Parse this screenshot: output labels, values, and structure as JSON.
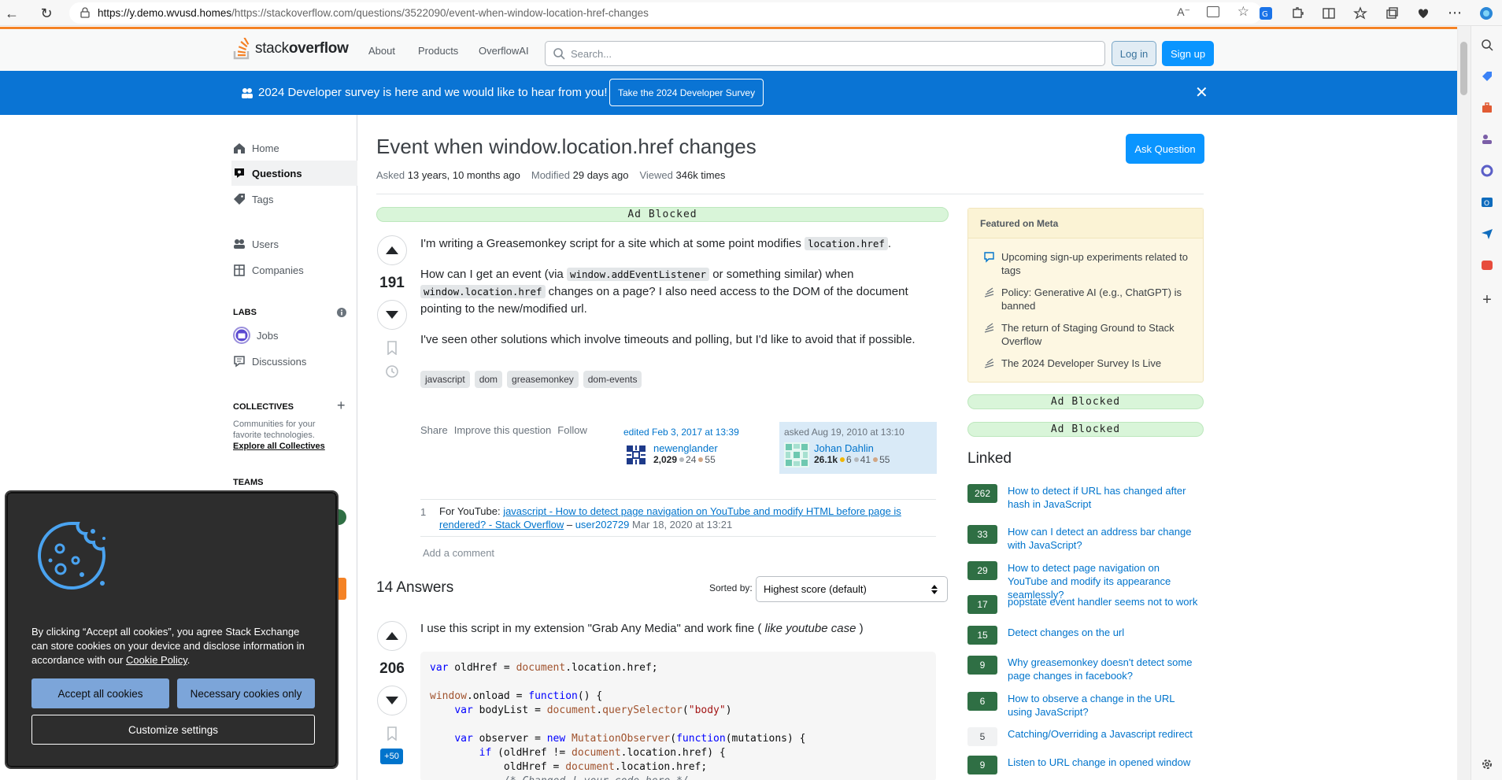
{
  "browser": {
    "url_host": "https://y.demo.wvusd.homes",
    "url_path": "/https://stackoverflow.com/questions/3522090/event-when-window-location-href-changes"
  },
  "header": {
    "logo_text_a": "stack",
    "logo_text_b": "overflow",
    "nav": [
      "About",
      "Products",
      "OverflowAI"
    ],
    "search_placeholder": "Search...",
    "login": "Log in",
    "signup": "Sign up"
  },
  "banner": {
    "message": "2024 Developer survey is here and we would like to hear from you!",
    "button": "Take the 2024 Developer Survey"
  },
  "sidebar": {
    "home": "Home",
    "questions": "Questions",
    "tags": "Tags",
    "users": "Users",
    "companies": "Companies",
    "labs_heading": "LABS",
    "jobs": "Jobs",
    "discussions": "Discussions",
    "collectives_heading": "COLLECTIVES",
    "collectives_desc": "Communities for your favorite technologies.",
    "collectives_link": "Explore all Collectives",
    "teams_heading": "TEAMS"
  },
  "question": {
    "title": "Event when window.location.href changes",
    "ask_button": "Ask Question",
    "asked_label": "Asked",
    "asked_value": "13 years, 10 months ago",
    "modified_label": "Modified",
    "modified_value": "29 days ago",
    "viewed_label": "Viewed",
    "viewed_value": "346k times",
    "score": "191",
    "p1_a": "I'm writing a Greasemonkey script for a site which at some point modifies ",
    "p1_code": "location.href",
    "p1_b": ".",
    "p2_a": "How can I get an event (via ",
    "p2_code1": "window.addEventListener",
    "p2_b": " or something similar) when",
    "p2_code2": "window.location.href",
    "p2_c": " changes on a page? I also need access to the DOM of the document pointing to the new/modified url.",
    "p3": "I've seen other solutions which involve timeouts and polling, but I'd like to avoid that if possible.",
    "tags": [
      "javascript",
      "dom",
      "greasemonkey",
      "dom-events"
    ],
    "menu": [
      "Share",
      "Improve this question",
      "Follow"
    ],
    "edited_label": "edited Feb 3, 2017 at 13:39",
    "editor_name": "newenglander",
    "editor_rep": "2,029",
    "editor_silver": "24",
    "editor_bronze": "55",
    "asked_box_label": "asked Aug 19, 2010 at 13:10",
    "author_name": "Johan Dahlin",
    "author_rep": "26.1k",
    "author_gold": "6",
    "author_silver": "41",
    "author_bronze": "55"
  },
  "comment": {
    "votes": "1",
    "prefix": "For YouTube: ",
    "link": "javascript - How to detect page navigation on YouTube and modify HTML before page is rendered? - Stack Overflow",
    "sep": " – ",
    "user": "user202729",
    "date": " Mar 18, 2020 at 13:21",
    "add": "Add a comment"
  },
  "answers": {
    "count": "14 Answers",
    "sorted_label": "Sorted by:",
    "sort_value": "Highest score (default)",
    "first_score": "206",
    "first_text_a": "I use this script in my extension \"Grab Any Media\" and work fine ( ",
    "first_text_em": "like youtube case",
    "first_text_b": " )",
    "bounty": "+50"
  },
  "ads": {
    "label": "Ad Blocked"
  },
  "meta": {
    "heading": "Featured on Meta",
    "items": [
      "Upcoming sign-up experiments related to tags",
      "Policy: Generative AI (e.g., ChatGPT) is banned",
      "The return of Staging Ground to Stack Overflow",
      "The 2024 Developer Survey Is Live"
    ]
  },
  "linked": {
    "heading": "Linked",
    "items": [
      {
        "score": "262",
        "title": "How to detect if URL has changed after hash in JavaScript",
        "accepted": true
      },
      {
        "score": "33",
        "title": "How can I detect an address bar change with JavaScript?",
        "accepted": true
      },
      {
        "score": "29",
        "title": "How to detect page navigation on YouTube and modify its appearance seamlessly?",
        "accepted": true
      },
      {
        "score": "17",
        "title": "popstate event handler seems not to work",
        "accepted": true
      },
      {
        "score": "15",
        "title": "Detect changes on the url",
        "accepted": true
      },
      {
        "score": "9",
        "title": "Why greasemonkey doesn't detect some page changes in facebook?",
        "accepted": true
      },
      {
        "score": "6",
        "title": "How to observe a change in the URL using JavaScript?",
        "accepted": true
      },
      {
        "score": "5",
        "title": "Catching/Overriding a Javascript redirect",
        "accepted": false
      },
      {
        "score": "9",
        "title": "Listen to URL change in opened window",
        "accepted": true
      }
    ]
  },
  "cookie": {
    "text": "By clicking “Accept all cookies”, you agree Stack Exchange can store cookies on your device and disclose information in accordance with our ",
    "link": "Cookie Policy",
    "accept": "Accept all cookies",
    "necessary": "Necessary cookies only",
    "customize": "Customize settings"
  }
}
